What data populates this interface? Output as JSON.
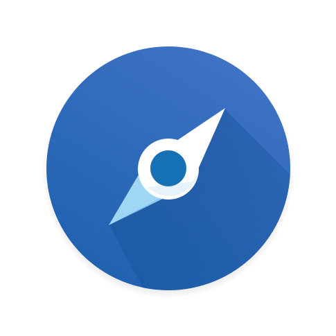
{
  "icon": {
    "name": "compass-icon",
    "colors": {
      "background": "#ffffff",
      "circle_top": "#3f72c4",
      "circle_bottom": "#1f62b0",
      "long_shadow": "#134f94",
      "needle_north": "#ffffff",
      "needle_south": "#9fd6f3",
      "hub_ring": "#ffffff",
      "hub_center": "#1672b4"
    }
  }
}
